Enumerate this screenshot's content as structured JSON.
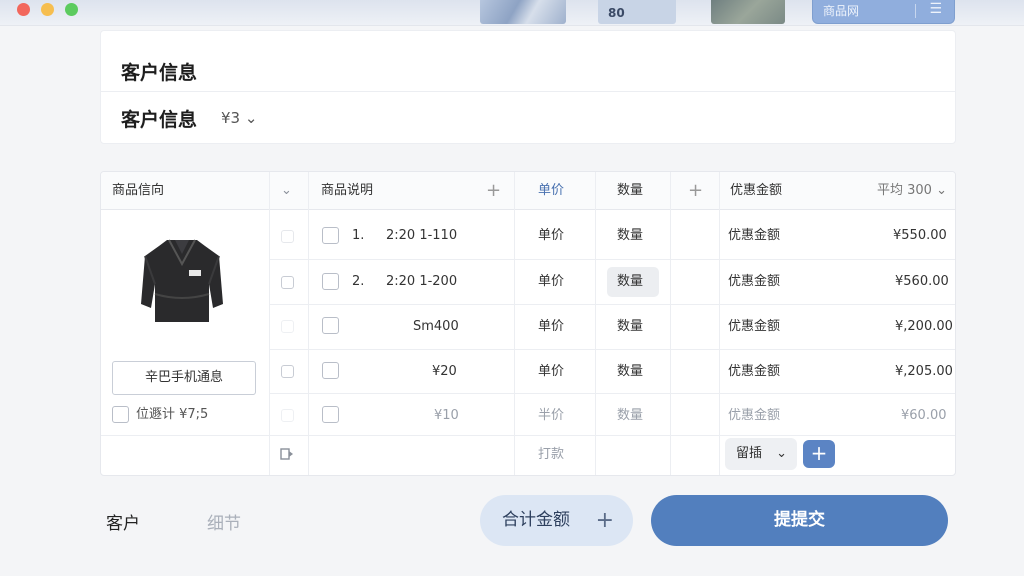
{
  "top_strip": {
    "thumb2_text": "80",
    "thumb4_text": "商品网",
    "thumb4_menu": "☰"
  },
  "customer_card": {
    "title1": "客户信息",
    "title2": "客户信息",
    "amount": "¥3 ⌄"
  },
  "table": {
    "headers": {
      "product_info": "商品信向",
      "expand": "⌄",
      "description": "商品说明",
      "add1": "+",
      "unit_price": "单价",
      "quantity": "数量",
      "add2": "+",
      "discount": "优惠金额",
      "right_filter": "平均 300 ⌄"
    },
    "rows": [
      {
        "num": "1.",
        "desc": "2:20 1-110",
        "price": "单价",
        "qty": "数量",
        "discount": "优惠金额",
        "amount": "¥550.00"
      },
      {
        "num": "2.",
        "desc": "2:20 1-200",
        "price": "单价",
        "qty": "数量",
        "discount": "优惠金额",
        "amount": "¥560.00"
      },
      {
        "num": "",
        "desc": "Sm400",
        "price": "单价",
        "qty": "数量",
        "discount": "优惠金额",
        "amount": "¥,200.00"
      },
      {
        "num": "",
        "desc": "¥20",
        "price": "单价",
        "qty": "数量",
        "discount": "优惠金额",
        "amount": "¥,205.00"
      },
      {
        "num": "",
        "desc": "¥10",
        "price": "半价",
        "qty": "数量",
        "discount": "优惠金额",
        "amount": "¥60.00"
      }
    ],
    "product_button": "辛巴手机通息",
    "product_check_label": "位遯计  ¥7;5",
    "footer_label": "打款",
    "footer_select": "留插",
    "footer_select_arrow": "⌄",
    "footer_plus": "+"
  },
  "bottom": {
    "customer_label": "客户",
    "detail_label": "细节",
    "total_button": "合计金额",
    "total_plus": "+",
    "submit_button": "提提交"
  },
  "colors": {
    "accent": "#527fbe",
    "accent_light": "#dce6f4",
    "plus_button": "#5b84c4",
    "muted_text": "#9aa0aa"
  }
}
